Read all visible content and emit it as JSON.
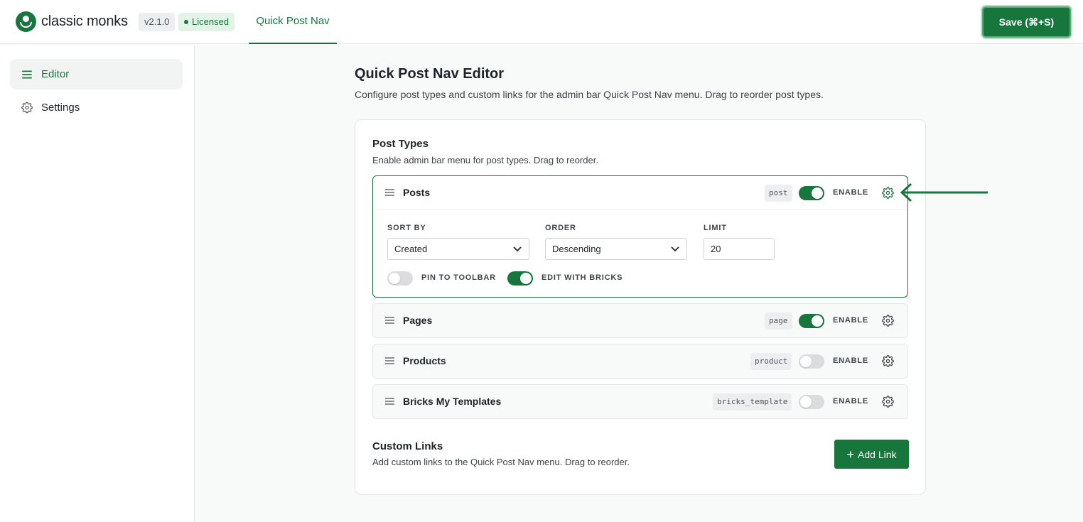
{
  "header": {
    "brand": "classic monks",
    "version": "v2.1.0",
    "license_status": "Licensed",
    "nav_tab": "Quick Post Nav",
    "save_label": "Save (⌘+S)"
  },
  "sidebar": {
    "items": [
      {
        "label": "Editor",
        "icon": "menu-icon",
        "active": true
      },
      {
        "label": "Settings",
        "icon": "gear-icon",
        "active": false
      }
    ]
  },
  "main": {
    "title": "Quick Post Nav Editor",
    "description": "Configure post types and custom links for the admin bar Quick Post Nav menu. Drag to reorder post types."
  },
  "post_types": {
    "title": "Post Types",
    "description": "Enable admin bar menu for post types. Drag to reorder.",
    "enable_label": "ENABLE",
    "items": [
      {
        "name": "Posts",
        "slug": "post",
        "enabled": true,
        "expanded": true
      },
      {
        "name": "Pages",
        "slug": "page",
        "enabled": true,
        "expanded": false
      },
      {
        "name": "Products",
        "slug": "product",
        "enabled": false,
        "expanded": false
      },
      {
        "name": "Bricks My Templates",
        "slug": "bricks_template",
        "enabled": false,
        "expanded": false
      }
    ],
    "settings": {
      "sort_by_label": "SORT BY",
      "sort_by_value": "Created",
      "order_label": "ORDER",
      "order_value": "Descending",
      "limit_label": "LIMIT",
      "limit_value": "20",
      "pin_label": "PIN TO TOOLBAR",
      "pin_enabled": false,
      "edit_bricks_label": "EDIT WITH BRICKS",
      "edit_bricks_enabled": true
    }
  },
  "custom_links": {
    "title": "Custom Links",
    "description": "Add custom links to the Quick Post Nav menu. Drag to reorder.",
    "add_label": "Add Link"
  },
  "colors": {
    "accent": "#16763c",
    "accent_light": "#e4f3e8",
    "toggle_off": "#dcdcde"
  }
}
